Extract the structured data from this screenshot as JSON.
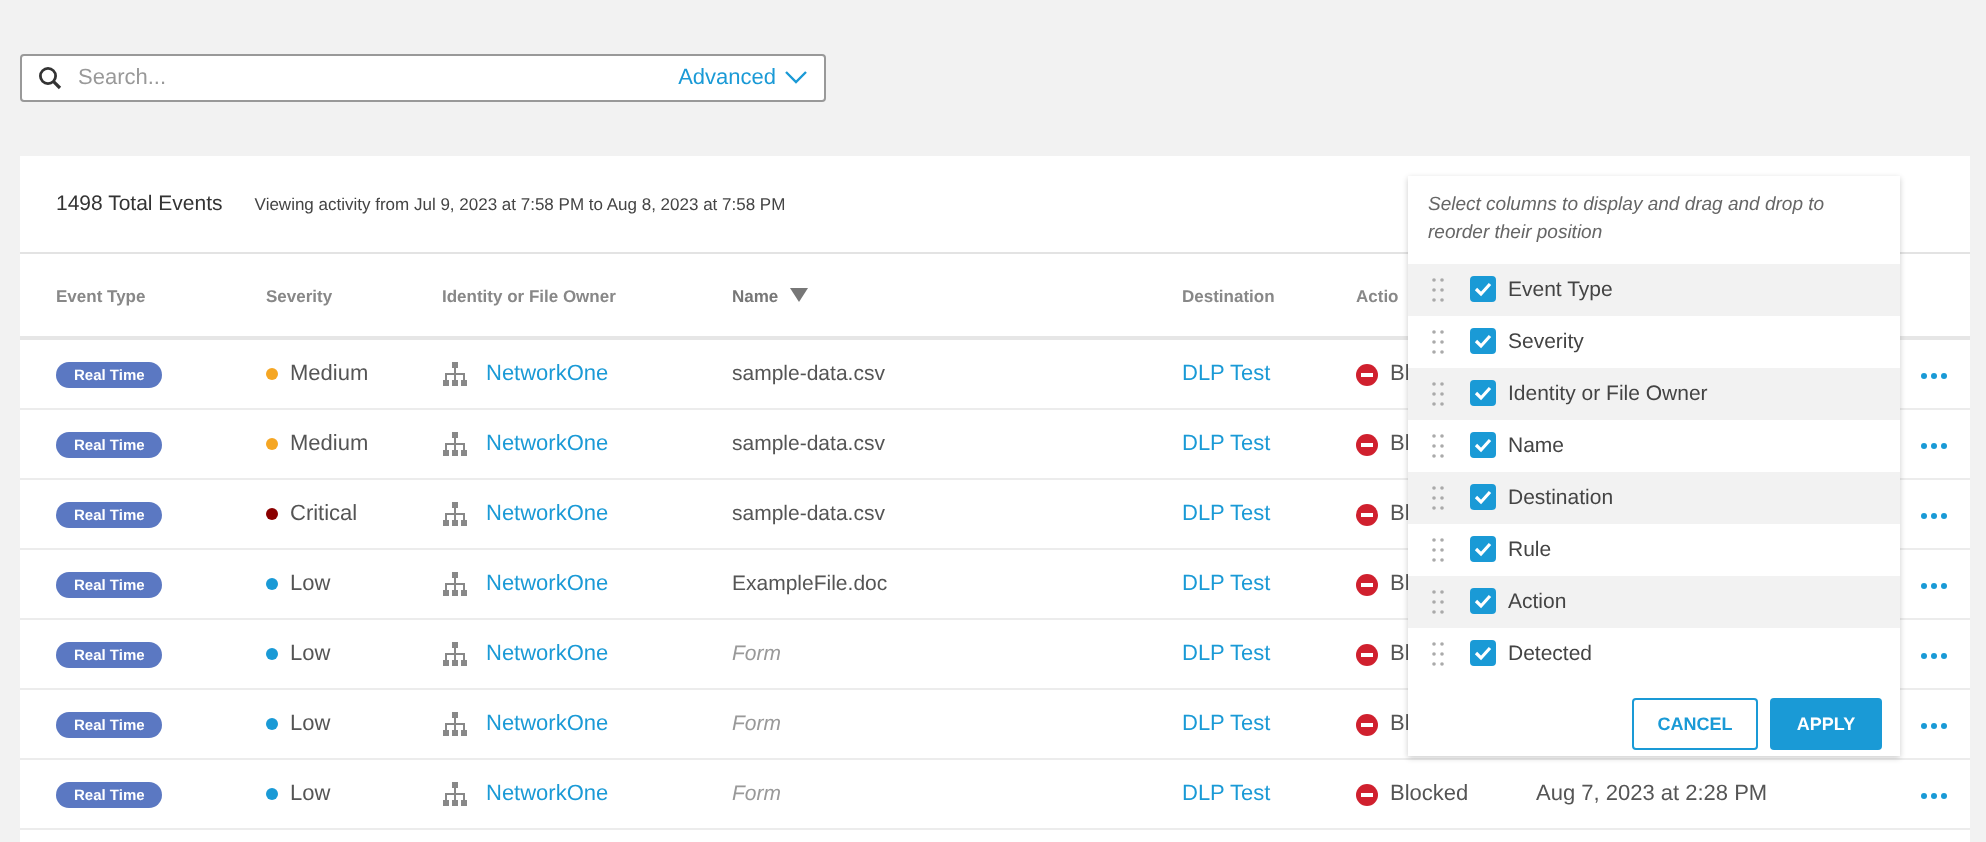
{
  "search": {
    "placeholder": "Search...",
    "advanced": "Advanced"
  },
  "summary": {
    "total": "1498 Total Events",
    "range": "Viewing activity from Jul 9, 2023 at 7:58 PM to Aug 8, 2023 at 7:58 PM"
  },
  "table": {
    "columns": [
      {
        "label": "Event Type",
        "sorted": false
      },
      {
        "label": "Severity",
        "sorted": false
      },
      {
        "label": "Identity or File Owner",
        "sorted": false
      },
      {
        "label": "Name",
        "sorted": true
      },
      {
        "label": "Destination",
        "sorted": false
      },
      {
        "label": "Actio",
        "sorted": false
      }
    ],
    "rows": [
      {
        "event_type": "Real Time",
        "severity": "Medium",
        "color": "#f5a623",
        "identity": "NetworkOne",
        "name": "sample-data.csv",
        "muted": false,
        "destination": "DLP Test",
        "action": "Bl",
        "detected": ""
      },
      {
        "event_type": "Real Time",
        "severity": "Medium",
        "color": "#f5a623",
        "identity": "NetworkOne",
        "name": "sample-data.csv",
        "muted": false,
        "destination": "DLP Test",
        "action": "Bl",
        "detected": ""
      },
      {
        "event_type": "Real Time",
        "severity": "Critical",
        "color": "#8b0000",
        "identity": "NetworkOne",
        "name": "sample-data.csv",
        "muted": false,
        "destination": "DLP Test",
        "action": "Bl",
        "detected": ""
      },
      {
        "event_type": "Real Time",
        "severity": "Low",
        "color": "#1a9ad6",
        "identity": "NetworkOne",
        "name": "ExampleFile.doc",
        "muted": false,
        "destination": "DLP Test",
        "action": "Bl",
        "detected": ""
      },
      {
        "event_type": "Real Time",
        "severity": "Low",
        "color": "#1a9ad6",
        "identity": "NetworkOne",
        "name": "Form",
        "muted": true,
        "destination": "DLP Test",
        "action": "Bl",
        "detected": ""
      },
      {
        "event_type": "Real Time",
        "severity": "Low",
        "color": "#1a9ad6",
        "identity": "NetworkOne",
        "name": "Form",
        "muted": true,
        "destination": "DLP Test",
        "action": "Bl",
        "detected": ""
      },
      {
        "event_type": "Real Time",
        "severity": "Low",
        "color": "#1a9ad6",
        "identity": "NetworkOne",
        "name": "Form",
        "muted": true,
        "destination": "DLP Test",
        "action": "Blocked",
        "detected": "Aug 7, 2023 at 2:28 PM"
      }
    ]
  },
  "column_picker": {
    "hint": "Select columns to display and drag and drop to reorder their position",
    "items": [
      {
        "label": "Event Type",
        "checked": true
      },
      {
        "label": "Severity",
        "checked": true
      },
      {
        "label": "Identity or File Owner",
        "checked": true
      },
      {
        "label": "Name",
        "checked": true
      },
      {
        "label": "Destination",
        "checked": true
      },
      {
        "label": "Rule",
        "checked": true
      },
      {
        "label": "Action",
        "checked": true
      },
      {
        "label": "Detected",
        "checked": true
      }
    ],
    "cancel": "CANCEL",
    "apply": "APPLY"
  }
}
